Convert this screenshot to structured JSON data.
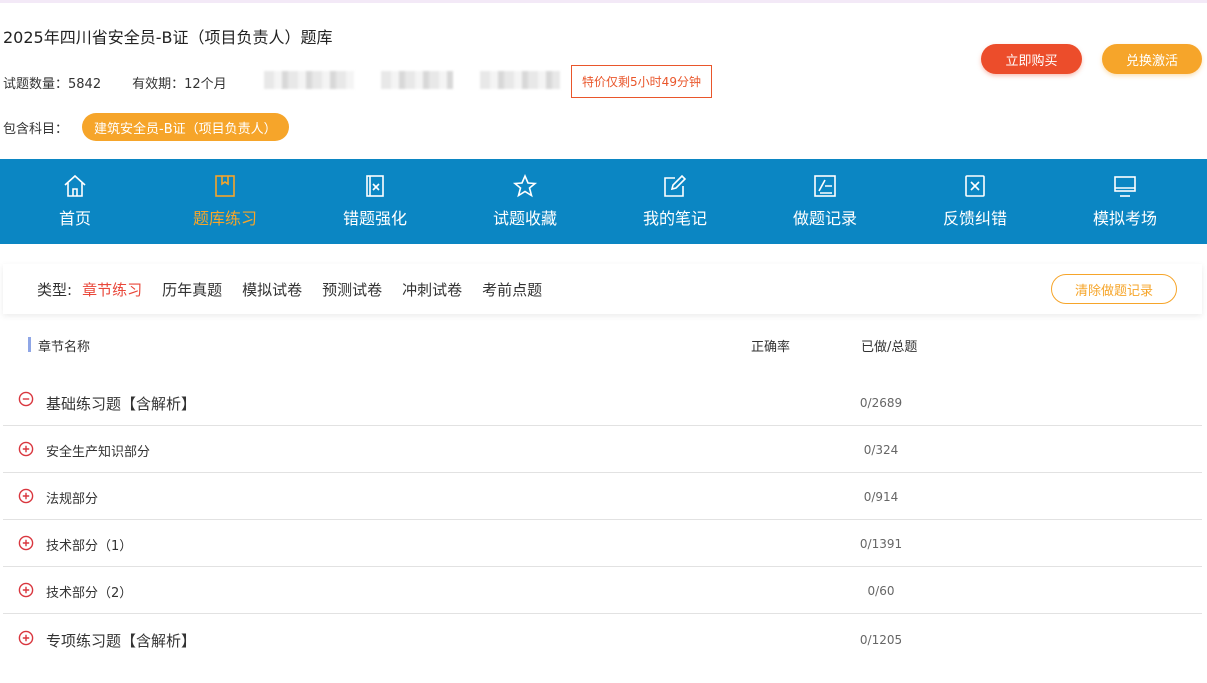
{
  "header": {
    "title": "2025年四川省安全员-B证（项目负责人）题库",
    "question_count_label": "试题数量：5842",
    "validity_label": "有效期：12个月",
    "countdown": "特价仅剩5小时49分钟",
    "buy_label": "立即购买",
    "redeem_label": "兑换激活",
    "subjects_label": "包含科目：",
    "subject_pill": "建筑安全员-B证（项目负责人）"
  },
  "colors": {
    "nav_bg": "#0b86c3",
    "accent_orange": "#f6a52a",
    "accent_red": "#ec4d2b",
    "toggle_red": "#d9363e"
  },
  "nav": [
    {
      "label": "首页",
      "icon": "home-icon"
    },
    {
      "label": "题库练习",
      "icon": "book-icon",
      "active": true
    },
    {
      "label": "错题强化",
      "icon": "wrong-question-icon"
    },
    {
      "label": "试题收藏",
      "icon": "star-icon"
    },
    {
      "label": "我的笔记",
      "icon": "edit-note-icon"
    },
    {
      "label": "做题记录",
      "icon": "record-icon"
    },
    {
      "label": "反馈纠错",
      "icon": "feedback-icon"
    },
    {
      "label": "模拟考场",
      "icon": "monitor-icon"
    }
  ],
  "filter": {
    "label": "类型:",
    "options": [
      "章节练习",
      "历年真题",
      "模拟试卷",
      "预测试卷",
      "冲刺试卷",
      "考前点题"
    ],
    "active_index": 0,
    "clear_label": "清除做题记录"
  },
  "table": {
    "headers": {
      "name": "章节名称",
      "accuracy": "正确率",
      "progress": "已做/总题"
    },
    "rows": [
      {
        "name": "基础练习题【含解析】",
        "progress": "0/2689",
        "expanded": true,
        "level": "top"
      },
      {
        "name": "安全生产知识部分",
        "progress": "0/324",
        "expanded": false,
        "level": "sub"
      },
      {
        "name": "法规部分",
        "progress": "0/914",
        "expanded": false,
        "level": "sub"
      },
      {
        "name": "技术部分（1）",
        "progress": "0/1391",
        "expanded": false,
        "level": "sub"
      },
      {
        "name": "技术部分（2）",
        "progress": "0/60",
        "expanded": false,
        "level": "sub"
      },
      {
        "name": "专项练习题【含解析】",
        "progress": "0/1205",
        "expanded": false,
        "level": "top"
      }
    ]
  }
}
